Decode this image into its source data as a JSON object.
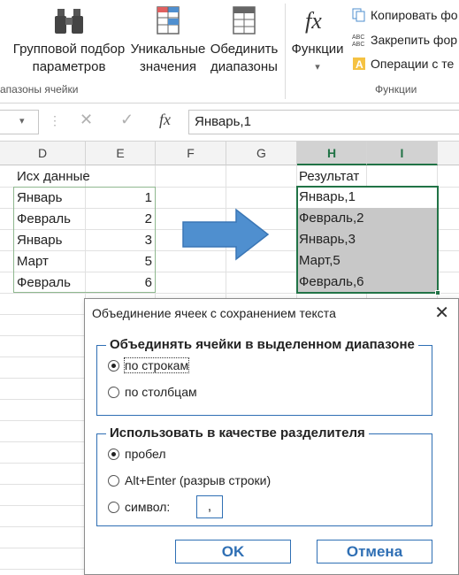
{
  "ribbon": {
    "buttons": [
      {
        "line1": "Групповой подбор",
        "line2": "параметров"
      },
      {
        "line1": "Уникальные",
        "line2": "значения"
      },
      {
        "line1": "Обединить",
        "line2": "диапазоны"
      },
      {
        "line1": "Функции",
        "line2": "▾"
      }
    ],
    "small_items": [
      "Копировать фо",
      "Закрепить фор",
      "Операции с те"
    ],
    "group_left": "апазоны ячейки",
    "group_right": "Функции"
  },
  "formula_bar": {
    "namebox_arrow": "▾",
    "dots": "⋮",
    "cancel": "✕",
    "enter": "✓",
    "fx": "fx",
    "value": "Январь,1"
  },
  "columns": [
    "D",
    "E",
    "F",
    "G",
    "H",
    "I"
  ],
  "source": {
    "header": "Исх данные",
    "rows": [
      {
        "name": "Январь",
        "value": "1"
      },
      {
        "name": "Февраль",
        "value": "2"
      },
      {
        "name": "Январь",
        "value": "3"
      },
      {
        "name": "Март",
        "value": "5"
      },
      {
        "name": "Февраль",
        "value": "6"
      }
    ]
  },
  "result": {
    "header": "Результат",
    "rows": [
      "Январь,1",
      "Февраль,2",
      "Январь,3",
      "Март,5",
      "Февраль,6"
    ]
  },
  "dialog": {
    "title": "Объединение ячеек с сохранением текста",
    "close": "✕",
    "group1": {
      "title": "Объединять ячейки в выделенном диапазоне",
      "options": [
        "по строкам",
        "по столбцам"
      ],
      "selected": 0
    },
    "group2": {
      "title": "Использовать в качестве разделителя",
      "options": [
        "пробел",
        "Alt+Enter (разрыв строки)",
        "символ:"
      ],
      "selected": 0,
      "symbol_value": ","
    },
    "ok_label": "OK",
    "cancel_label": "Отмена"
  },
  "colors": {
    "accent_green": "#217346",
    "dialog_blue": "#2f6fb4",
    "arrow_blue": "#4f8fcf",
    "selection_gray": "#c8c8c8"
  }
}
